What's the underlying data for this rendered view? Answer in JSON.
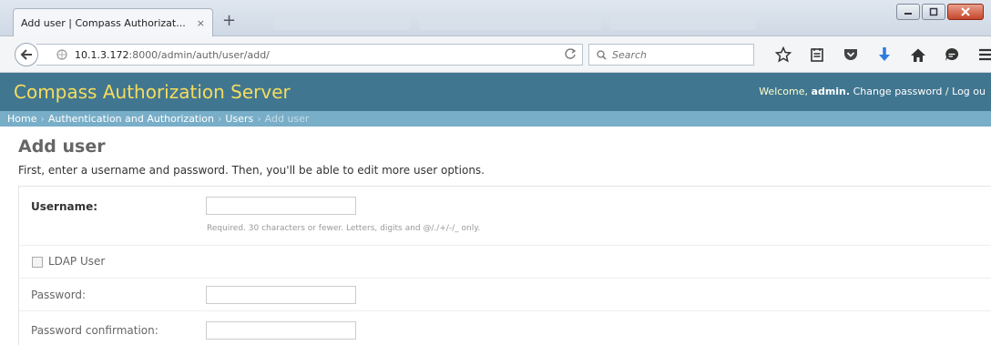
{
  "browser": {
    "tab_title": "Add user | Compass Authorizat...",
    "tab_close": "×",
    "new_tab": "+",
    "url_host": "10.1.3.172",
    "url_rest": ":8000/admin/auth/user/add/",
    "search_placeholder": "Search",
    "window_controls": [
      "minimize",
      "maximize",
      "close"
    ]
  },
  "header": {
    "site_title": "Compass Authorization Server",
    "welcome": "Welcome,",
    "username": "admin.",
    "change_password": "Change password",
    "separator": "/",
    "logout": "Log ou"
  },
  "breadcrumbs": {
    "home": "Home",
    "app": "Authentication and Authorization",
    "model": "Users",
    "current": "Add user",
    "sep": "›"
  },
  "page": {
    "title": "Add user",
    "intro": "First, enter a username and password. Then, you'll be able to edit more user options."
  },
  "form": {
    "username_label": "Username:",
    "username_value": "",
    "username_help": "Required. 30 characters or fewer. Letters, digits and @/./+/-/_ only.",
    "ldap_label": "LDAP User",
    "ldap_checked": false,
    "password_label": "Password:",
    "password_confirm_label": "Password confirmation:"
  },
  "colors": {
    "header_bg": "#417690",
    "breadcrumb_bg": "#79aec8",
    "site_title": "#f5dd5d"
  }
}
